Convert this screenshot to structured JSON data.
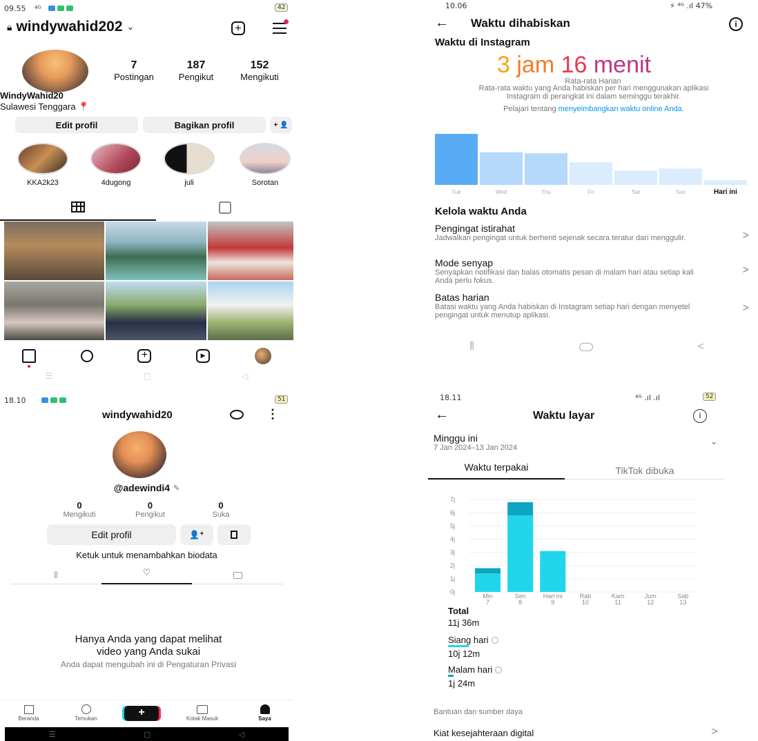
{
  "ig_profile": {
    "status_time": "09.55",
    "status_signal": "⁴ᴳ",
    "battery": "42",
    "username": "windywahid202",
    "stats": [
      {
        "value": "7",
        "label": "Postingan"
      },
      {
        "value": "187",
        "label": "Pengikut"
      },
      {
        "value": "152",
        "label": "Mengikuti"
      }
    ],
    "display_name": "WindyWahid20",
    "location": "Sulawesi Tenggara 📍",
    "edit_label": "Edit profil",
    "share_label": "Bagikan profil",
    "add_person_label": "+ 👤",
    "highlights": [
      {
        "label": "KKA2k23"
      },
      {
        "label": "4dugong"
      },
      {
        "label": "juli"
      },
      {
        "label": "Sorotan"
      }
    ]
  },
  "ig_time": {
    "status_time": "10.06",
    "status_right": "⚡ ⁴ᴳ .ıl 47%",
    "title": "Waktu dihabiskan",
    "section_title": "Waktu di Instagram",
    "big_parts": [
      "3 ",
      "jam ",
      "16 ",
      "menit"
    ],
    "avg_label": "Rata-rata Harian",
    "desc": "Rata-rata waktu yang Anda habiskan per hari menggunakan aplikasi Instagram di perangkat ini dalam seminggu terakhir.",
    "learn_prefix": "Pelajari tentang ",
    "learn_link": "menyeimbangkan waktu online Anda",
    "learn_suffix": ".",
    "chart_data": {
      "type": "bar",
      "categories": [
        "Tue",
        "Wed",
        "Thu",
        "Fri",
        "Sat",
        "Sun",
        "Hari ini"
      ],
      "values": [
        1.0,
        0.64,
        0.62,
        0.44,
        0.28,
        0.32,
        0.09
      ],
      "colors": [
        "#5aabf5",
        "#b5d9fb",
        "#b5d9fb",
        "#daecfd",
        "#daecfd",
        "#daecfd",
        "#daecfd"
      ]
    },
    "manage_title": "Kelola waktu Anda",
    "items": [
      {
        "title": "Pengingat istirahat",
        "desc": "Jadwalkan pengingat untuk berhenti sejenak secara teratur dari menggulir."
      },
      {
        "title": "Mode senyap",
        "desc": "Senyapkan notifikasi dan balas otomatis pesan di malam hari atau setiap kali Anda perlu fokus."
      },
      {
        "title": "Batas harian",
        "desc": "Batasi waktu yang Anda habiskan di Instagram setiap hari dengan menyetel pengingat untuk menutup aplikasi."
      }
    ],
    "chevron": ">"
  },
  "tiktok_profile": {
    "status_time": "18.10",
    "battery": "51",
    "username": "windywahid20",
    "handle": "@adewindi4",
    "stats": [
      {
        "value": "0",
        "label": "Mengikuti"
      },
      {
        "value": "0",
        "label": "Pengikut"
      },
      {
        "value": "0",
        "label": "Suka"
      }
    ],
    "edit_label": "Edit profil",
    "bio_hint": "Ketuk untuk menambahkan biodata",
    "empty_title": "Hanya Anda yang dapat melihat video yang Anda sukai",
    "empty_sub": "Anda dapat mengubah ini di Pengaturan Privasi",
    "nav": [
      {
        "label": "Beranda"
      },
      {
        "label": "Temukan"
      },
      {
        "label": "Kotak Masuk"
      },
      {
        "label": "Saya"
      }
    ]
  },
  "tiktok_time": {
    "status_time": "18.11",
    "status_right": "⁴ᴳ .ıl .ıl",
    "battery": "52",
    "title": "Waktu layar",
    "week_title": "Minggu ini",
    "week_range": "7 Jan 2024–13 Jan 2024",
    "tabs": [
      "Waktu terpakai",
      "TikTok dibuka"
    ],
    "y_labels": [
      "7j",
      "6j",
      "5j",
      "4j",
      "3j",
      "2j",
      "1j",
      "0j"
    ],
    "chart_data": {
      "type": "bar",
      "categories": [
        "Min 7",
        "Sen 8",
        "Hari ini 9",
        "Rab 10",
        "Kam 11",
        "Jum 12",
        "Sab 13"
      ],
      "x_day": [
        "Min",
        "Sen",
        "Hari ini",
        "Rab",
        "Kam",
        "Jum",
        "Sab"
      ],
      "x_date": [
        "7",
        "8",
        "9",
        "10",
        "11",
        "12",
        "13"
      ],
      "series": [
        {
          "name": "Siang hari",
          "values": [
            1.4,
            5.8,
            3.1,
            0,
            0,
            0,
            0
          ]
        },
        {
          "name": "Malam hari",
          "values": [
            0.4,
            1.0,
            0,
            0,
            0,
            0,
            0
          ]
        }
      ],
      "ylim": [
        0,
        7
      ]
    },
    "total_label": "Total",
    "total_value": "11j 36m",
    "day_label": "Siang hari",
    "day_value": "10j 12m",
    "night_label": "Malam hari",
    "night_value": "1j 24m",
    "help_label": "Bantuan dan sumber daya",
    "wellbeing_label": "Kiat kesejahteraan digital",
    "chevron": ">"
  },
  "colors": {
    "ig_blue": "#0095f6",
    "tiktok_cyan": "#20d5ec",
    "tiktok_dark_cyan": "#0ea5c0",
    "tiktok_pink": "#fe2c55"
  }
}
